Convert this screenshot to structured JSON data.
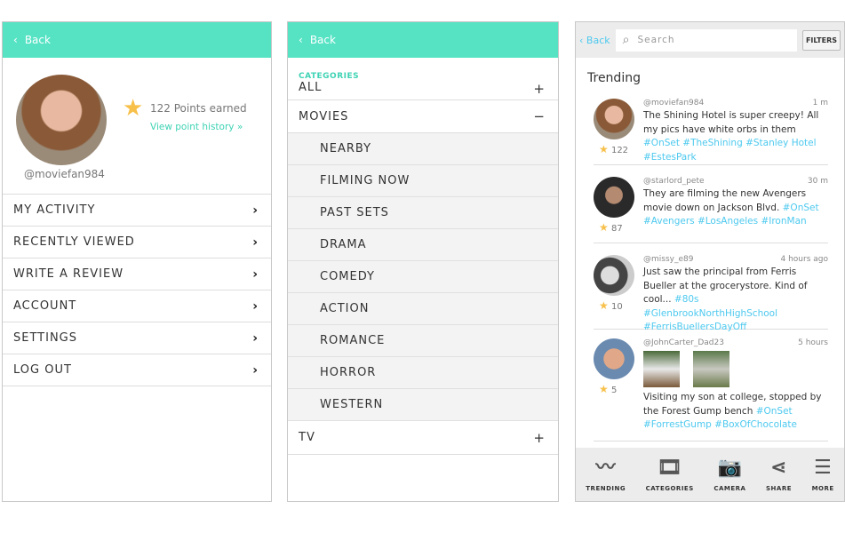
{
  "colors": {
    "accent": "#55e3c4",
    "link": "#4dc9ef",
    "star": "#f7c04a"
  },
  "profile": {
    "back": "Back",
    "points": "122 Points earned",
    "history": "View point history  »",
    "username": "@moviefan984",
    "menu": [
      "MY ACTIVITY",
      "RECENTLY VIEWED",
      "WRITE A REVIEW",
      "ACCOUNT",
      "SETTINGS",
      "LOG OUT"
    ]
  },
  "categories": {
    "back": "Back",
    "label": "CATEGORIES",
    "all": "ALL",
    "movies": "MOVIES",
    "tv": "TV",
    "plus": "+",
    "minus": "−",
    "sub": [
      "NEARBY",
      "FILMING NOW",
      "PAST SETS",
      "DRAMA",
      "COMEDY",
      "ACTION",
      "ROMANCE",
      "HORROR",
      "WESTERN"
    ]
  },
  "feed": {
    "back": "Back",
    "search_placeholder": "Search",
    "filters": "FILTERS",
    "title": "Trending",
    "posts": [
      {
        "user": "@moviefan984",
        "time": "1 m",
        "points": "122",
        "text": "The Shining Hotel is super creepy!  All my pics have white orbs in them ",
        "tags": "#OnSet #TheShining  #Stanley Hotel  #EstesPark"
      },
      {
        "user": "@starlord_pete",
        "time": "30 m",
        "points": "87",
        "text": "They are filming the new Avengers movie down on Jackson Blvd.  ",
        "tags": "#OnSet #Avengers  #LosAngeles  #IronMan"
      },
      {
        "user": "@missy_e89",
        "time": "4 hours ago",
        "points": "10",
        "text": "Just saw the principal from Ferris Bueller at the grocerystore.  Kind of cool...  ",
        "tags": "#80s #GlenbrookNorthHighSchool #FerrisBuellersDayOff"
      },
      {
        "user": "@JohnCarter_Dad23",
        "time": "5 hours",
        "points": "5",
        "text": "Visiting my son at college, stopped by the Forest Gump bench ",
        "tags": "#OnSet #ForrestGump  #BoxOfChocolate"
      }
    ],
    "nav": [
      "TRENDING",
      "CATEGORIES",
      "CAMERA",
      "SHARE",
      "MORE"
    ]
  }
}
